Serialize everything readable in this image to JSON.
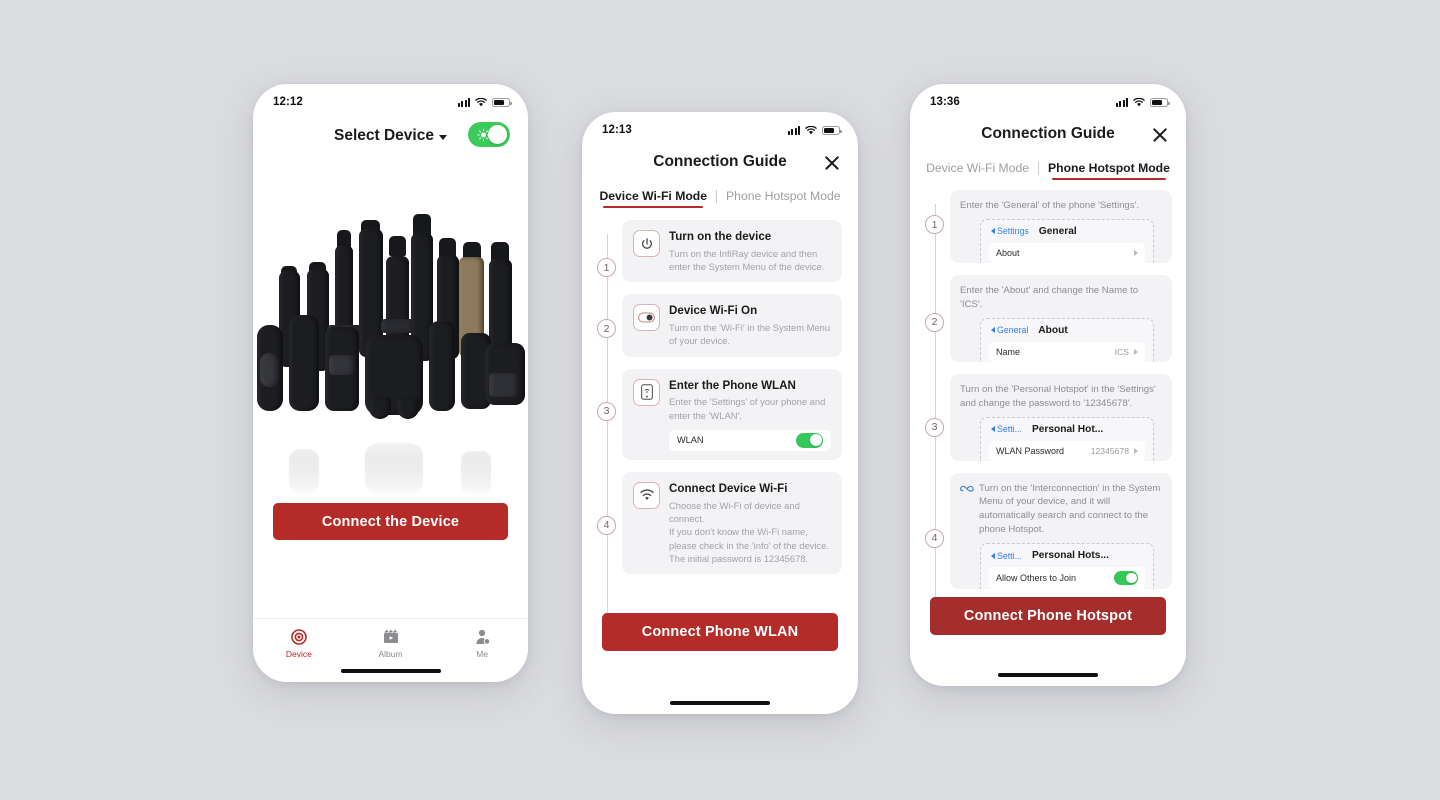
{
  "background_color": "#dbdce0",
  "accent_red": "#b52b28",
  "accent_red_dark": "#a32e2b",
  "toggle_green": "#34c759",
  "phone1": {
    "status": {
      "time": "12:12",
      "signal_icon": "cellular-signal-icon",
      "wifi_icon": "wifi-icon",
      "battery_icon": "battery-icon"
    },
    "header": {
      "title": "Select Device",
      "caret_icon": "chevron-down-icon",
      "toggle_icon": "brightness-toggle",
      "toggle_on": true
    },
    "hero": {
      "alt": "infiray-devices-product-photo"
    },
    "cta_label": "Connect the Device",
    "tabs": [
      {
        "label": "Device",
        "icon": "target-icon",
        "active": true
      },
      {
        "label": "Album",
        "icon": "film-clapper-icon",
        "active": false
      },
      {
        "label": "Me",
        "icon": "person-icon",
        "active": false
      }
    ]
  },
  "phone2": {
    "status": {
      "time": "12:13",
      "signal_icon": "cellular-signal-icon",
      "wifi_icon": "wifi-icon",
      "battery_icon": "battery-icon"
    },
    "title": "Connection Guide",
    "close_icon": "close-icon",
    "tabs": [
      {
        "label": "Device Wi-Fi Mode",
        "active": true
      },
      {
        "label": "Phone Hotspot Mode",
        "active": false
      }
    ],
    "steps": [
      {
        "number": "1",
        "icon": "power-icon",
        "title": "Turn on the device",
        "desc": "Turn on the InfiRay device and then enter the System Menu of the device."
      },
      {
        "number": "2",
        "icon": "toggle-icon",
        "title": "Device Wi-Fi On",
        "desc": "Turn on the 'Wi-Fi' in the System Menu of your device."
      },
      {
        "number": "3",
        "icon": "phone-wifi-icon",
        "title": "Enter the Phone WLAN",
        "desc": "Enter the 'Settings' of your phone and enter the 'WLAN'.",
        "row": {
          "label": "WLAN",
          "toggle_on": true
        }
      },
      {
        "number": "4",
        "icon": "wifi-icon",
        "title": "Connect Device Wi-Fi",
        "desc": "Choose the Wi-Fi of device and connect.\nIf you don't know the Wi-Fi name, please check in the 'info' of the device. The initial password is 12345678."
      }
    ],
    "cta_label": "Connect Phone WLAN"
  },
  "phone3": {
    "status": {
      "time": "13:36",
      "signal_icon": "cellular-signal-icon",
      "wifi_icon": "wifi-icon",
      "battery_icon": "battery-icon"
    },
    "title": "Connection Guide",
    "close_icon": "close-icon",
    "tabs": [
      {
        "label": "Device Wi-Fi Mode",
        "active": false
      },
      {
        "label": "Phone Hotspot Mode",
        "active": true
      }
    ],
    "steps": [
      {
        "number": "1",
        "desc": "Enter the 'General' of the phone 'Settings'.",
        "mock": {
          "back": "Settings",
          "head": "General",
          "row_label": "About",
          "row_value": "",
          "row_chevron": true
        }
      },
      {
        "number": "2",
        "desc": "Enter the 'About' and change the Name to 'ICS'.",
        "mock": {
          "back": "General",
          "head": "About",
          "row_label": "Name",
          "row_value": "ICS",
          "row_chevron": true
        }
      },
      {
        "number": "3",
        "desc": "Turn on the 'Personal Hotspot' in the 'Settings' and change the password to '12345678'.",
        "mock": {
          "back": "Setti...",
          "head": "Personal Hot...",
          "row_label": "WLAN Password",
          "row_value": "12345678",
          "row_chevron": true
        }
      },
      {
        "number": "4",
        "icon": "interconnection-icon",
        "desc": "Turn on the 'Interconnection' in the System Menu of your device, and it will automatically search and connect to the phone Hotspot.",
        "mock": {
          "back": "Setti...",
          "head": "Personal Hots...",
          "row_label": "Allow Others to Join",
          "row_toggle_on": true
        }
      }
    ],
    "cta_label": "Connect Phone Hotspot"
  }
}
